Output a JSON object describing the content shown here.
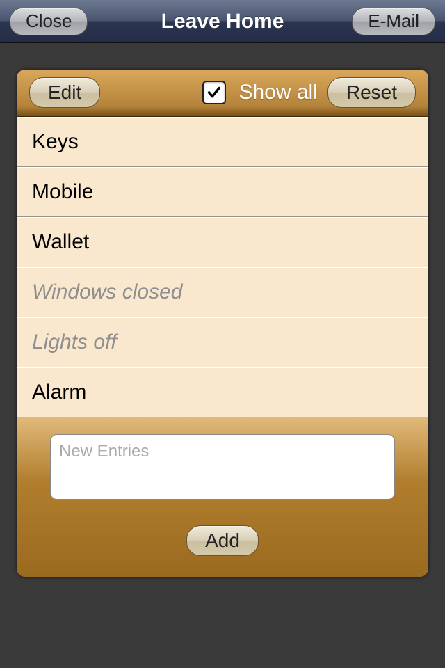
{
  "nav": {
    "close": "Close",
    "title": "Leave Home",
    "email": "E-Mail"
  },
  "toolbar": {
    "edit": "Edit",
    "showAll": "Show all",
    "showAllChecked": true,
    "reset": "Reset"
  },
  "items": [
    {
      "label": "Keys",
      "dim": false
    },
    {
      "label": "Mobile",
      "dim": false
    },
    {
      "label": "Wallet",
      "dim": false
    },
    {
      "label": "Windows closed",
      "dim": true
    },
    {
      "label": "Lights off",
      "dim": true
    },
    {
      "label": "Alarm",
      "dim": false
    }
  ],
  "input": {
    "placeholder": "New Entries"
  },
  "add": "Add"
}
